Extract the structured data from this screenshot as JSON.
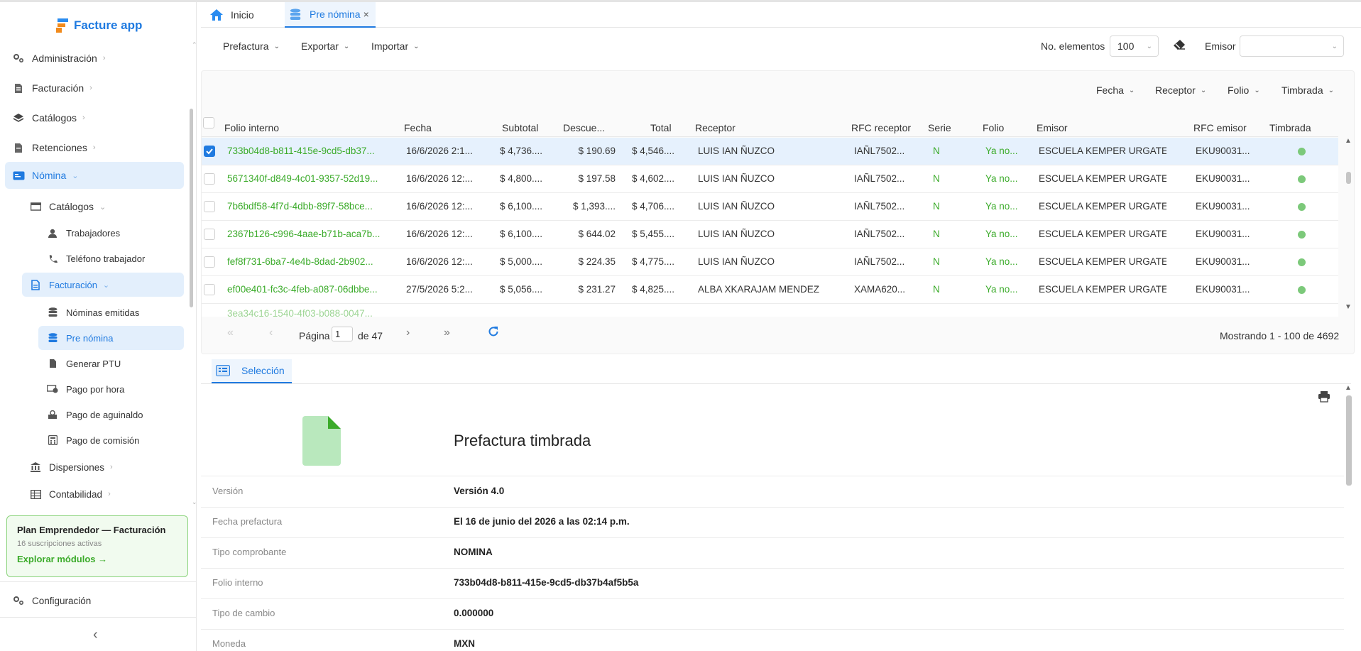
{
  "app": {
    "name": "Facture app"
  },
  "sidebar": {
    "items": [
      {
        "label": "Administración"
      },
      {
        "label": "Facturación"
      },
      {
        "label": "Catálogos"
      },
      {
        "label": "Retenciones"
      },
      {
        "label": "Nómina"
      }
    ],
    "nomina": {
      "catalogos": "Catálogos",
      "trabajadores": "Trabajadores",
      "telefono": "Teléfono trabajador",
      "facturacion": "Facturación",
      "nominas_emitidas": "Nóminas emitidas",
      "pre_nomina": "Pre nómina",
      "generar_ptu": "Generar PTU",
      "pago_hora": "Pago por hora",
      "pago_aguinaldo": "Pago de aguinaldo",
      "pago_comision": "Pago de comisión",
      "dispersiones": "Dispersiones",
      "contabilidad": "Contabilidad"
    },
    "plan": {
      "title": "Plan Emprendedor — Facturación",
      "subtitle": "16 suscripciones activas",
      "link": "Explorar módulos →"
    },
    "config": "Configuración",
    "collapse": "‹"
  },
  "tabs": [
    {
      "label": "Inicio"
    },
    {
      "label": "Pre nómina",
      "close": "×"
    }
  ],
  "toolbar": {
    "prefactura": "Prefactura",
    "exportar": "Exportar",
    "importar": "Importar",
    "no_elementos": "No. elementos",
    "page_size": "100",
    "emisor": "Emisor",
    "emisor_value": ""
  },
  "filters": {
    "fecha": "Fecha",
    "receptor": "Receptor",
    "folio": "Folio",
    "timbrada": "Timbrada"
  },
  "table": {
    "headers": [
      "Folio interno",
      "Fecha",
      "Subtotal",
      "Descue...",
      "Total",
      "Receptor",
      "RFC receptor",
      "Serie",
      "Folio",
      "Emisor",
      "RFC emisor",
      "Timbrada"
    ],
    "rows": [
      {
        "folio_interno": "733b04d8-b811-415e-9cd5-db37...",
        "fecha": "16/6/2026 2:1...",
        "subtotal": "$ 4,736....",
        "descuento": "$ 190.69",
        "total": "$ 4,546....",
        "receptor": "LUIS IAN ÑUZCO",
        "rfc_receptor": "IAÑL7502...",
        "serie": "N",
        "folio": "Ya no...",
        "emisor": "ESCUELA KEMPER URGATE",
        "rfc_emisor": "EKU90031...",
        "selected": true
      },
      {
        "folio_interno": "5671340f-d849-4c01-9357-52d19...",
        "fecha": "16/6/2026 12:...",
        "subtotal": "$ 4,800....",
        "descuento": "$ 197.58",
        "total": "$ 4,602....",
        "receptor": "LUIS IAN ÑUZCO",
        "rfc_receptor": "IAÑL7502...",
        "serie": "N",
        "folio": "Ya no...",
        "emisor": "ESCUELA KEMPER URGATE",
        "rfc_emisor": "EKU90031...",
        "selected": false
      },
      {
        "folio_interno": "7b6bdf58-4f7d-4dbb-89f7-58bce...",
        "fecha": "16/6/2026 12:...",
        "subtotal": "$ 6,100....",
        "descuento": "$ 1,393....",
        "total": "$ 4,706....",
        "receptor": "LUIS IAN ÑUZCO",
        "rfc_receptor": "IAÑL7502...",
        "serie": "N",
        "folio": "Ya no...",
        "emisor": "ESCUELA KEMPER URGATE",
        "rfc_emisor": "EKU90031...",
        "selected": false
      },
      {
        "folio_interno": "2367b126-c996-4aae-b71b-aca7b...",
        "fecha": "16/6/2026 12:...",
        "subtotal": "$ 6,100....",
        "descuento": "$ 644.02",
        "total": "$ 5,455....",
        "receptor": "LUIS IAN ÑUZCO",
        "rfc_receptor": "IAÑL7502...",
        "serie": "N",
        "folio": "Ya no...",
        "emisor": "ESCUELA KEMPER URGATE",
        "rfc_emisor": "EKU90031...",
        "selected": false
      },
      {
        "folio_interno": "fef8f731-6ba7-4e4b-8dad-2b902...",
        "fecha": "16/6/2026 12:...",
        "subtotal": "$ 5,000....",
        "descuento": "$ 224.35",
        "total": "$ 4,775....",
        "receptor": "LUIS IAN ÑUZCO",
        "rfc_receptor": "IAÑL7502...",
        "serie": "N",
        "folio": "Ya no...",
        "emisor": "ESCUELA KEMPER URGATE",
        "rfc_emisor": "EKU90031...",
        "selected": false
      },
      {
        "folio_interno": "ef00e401-fc3c-4feb-a087-06dbbe...",
        "fecha": "27/5/2026 5:2...",
        "subtotal": "$ 5,056....",
        "descuento": "$ 231.27",
        "total": "$ 4,825....",
        "receptor": "ALBA XKARAJAM MENDEZ",
        "rfc_receptor": "XAMA620...",
        "serie": "N",
        "folio": "Ya no...",
        "emisor": "ESCUELA KEMPER URGATE",
        "rfc_emisor": "EKU90031...",
        "selected": false
      }
    ]
  },
  "pager": {
    "pagina": "Página",
    "page": "1",
    "de": "de 47",
    "mostrando": "Mostrando 1 - 100 de 4692"
  },
  "detail": {
    "tab": "Selección",
    "title": "Prefactura timbrada",
    "fields": [
      {
        "label": "Versión",
        "value": "Versión 4.0"
      },
      {
        "label": "Fecha prefactura",
        "value": "El 16 de junio del 2026 a las 02:14 p.m."
      },
      {
        "label": "Tipo comprobante",
        "value": "NOMINA"
      },
      {
        "label": "Folio interno",
        "value": "733b04d8-b811-415e-9cd5-db37b4af5b5a"
      },
      {
        "label": "Tipo de cambio",
        "value": "0.000000"
      },
      {
        "label": "Moneda",
        "value": "MXN"
      }
    ]
  },
  "colors": {
    "accent": "#1f7ae0",
    "green": "#3bab2a",
    "timbrada_dot": "#7cc97a",
    "doc_icon": "#b9e8bd"
  }
}
